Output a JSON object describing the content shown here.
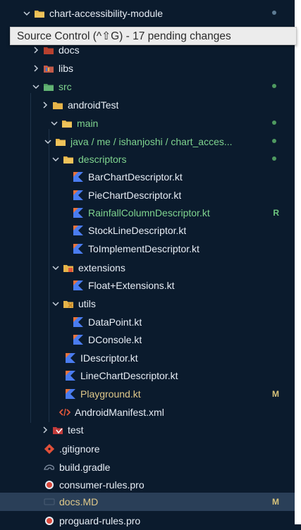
{
  "tooltip": {
    "text": "Source Control (^⇧G) - 17 pending changes"
  },
  "tree": {
    "root": {
      "label": "chart-accessibility-module"
    },
    "docs_folder": {
      "label": "docs"
    },
    "libs": {
      "label": "libs"
    },
    "src": {
      "label": "src"
    },
    "androidTest": {
      "label": "androidTest"
    },
    "main": {
      "label": "main"
    },
    "java_path": {
      "label": "java / me / ishanjoshi / chart_acces..."
    },
    "descriptors": {
      "label": "descriptors"
    },
    "files_descriptors": [
      {
        "label": "BarChartDescriptor.kt",
        "status": ""
      },
      {
        "label": "PieChartDescriptor.kt",
        "status": ""
      },
      {
        "label": "RainfallColumnDescriptor.kt",
        "status": "R"
      },
      {
        "label": "StockLineDescriptor.kt",
        "status": ""
      },
      {
        "label": "ToImplementDescriptor.kt",
        "status": ""
      }
    ],
    "extensions": {
      "label": "extensions"
    },
    "float_ext": {
      "label": "Float+Extensions.kt"
    },
    "utils": {
      "label": "utils"
    },
    "files_utils": [
      {
        "label": "DataPoint.kt"
      },
      {
        "label": "DConsole.kt"
      }
    ],
    "files_main": [
      {
        "label": "IDescriptor.kt",
        "status": ""
      },
      {
        "label": "LineChartDescriptor.kt",
        "status": ""
      },
      {
        "label": "Playground.kt",
        "status": "M"
      }
    ],
    "manifest": {
      "label": "AndroidManifest.xml"
    },
    "test": {
      "label": "test"
    },
    "root_files": [
      {
        "label": ".gitignore",
        "status": ""
      },
      {
        "label": "build.gradle",
        "status": ""
      },
      {
        "label": "consumer-rules.pro",
        "status": ""
      },
      {
        "label": "docs.MD",
        "status": "M"
      },
      {
        "label": "proguard-rules.pro",
        "status": ""
      }
    ]
  },
  "colors": {
    "background": "#0b1b2d",
    "selected_row": "#2a3f58",
    "modified": "#d6c27a",
    "renamed": "#6ec77f",
    "folder": "#e6b449",
    "kotlin_blue": "#4a7cf0",
    "kotlin_orange": "#e8733a"
  },
  "icons": {
    "folder": "folder-icon",
    "kotlin": "kotlin-file-icon",
    "xml": "xml-file-icon",
    "git": "git-icon",
    "gradle": "gradle-icon",
    "pro": "proguard-icon",
    "markdown": "markdown-icon"
  }
}
